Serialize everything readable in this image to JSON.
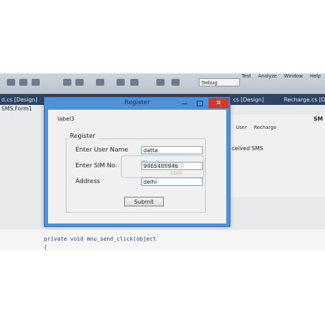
{
  "ide": {
    "menu": [
      "Test",
      "Analyze",
      "Window",
      "Help"
    ],
    "config": "Debug",
    "tabs": [
      "d.cs [Design]",
      "cs [Design]",
      "Recharge.cs [Desi"
    ],
    "designer_caption": "SMS.Form1",
    "bg_form": {
      "menu": [
        "User",
        "Recharge"
      ],
      "label": "ceived SMS",
      "corner": "SM"
    },
    "code_line_1": "private void mnu_send_click(object",
    "code_line_2": "{"
  },
  "dialog": {
    "title": "Register",
    "close_glyph": "✕",
    "label3": "label3",
    "group_title": "Register",
    "fields": [
      {
        "label": "Enter User Name",
        "value": "datta"
      },
      {
        "label": "Enter SIM No.",
        "value": "9465485946"
      },
      {
        "label": "Address",
        "value": "delhi"
      }
    ],
    "submit_label": "Submit"
  },
  "watermark": {
    "line1": "Technacs",
    "line2": ".com"
  },
  "colors": {
    "title_bar": "#4f90d8",
    "close": "#cf3a2f",
    "tab_strip": "#2f4463"
  }
}
